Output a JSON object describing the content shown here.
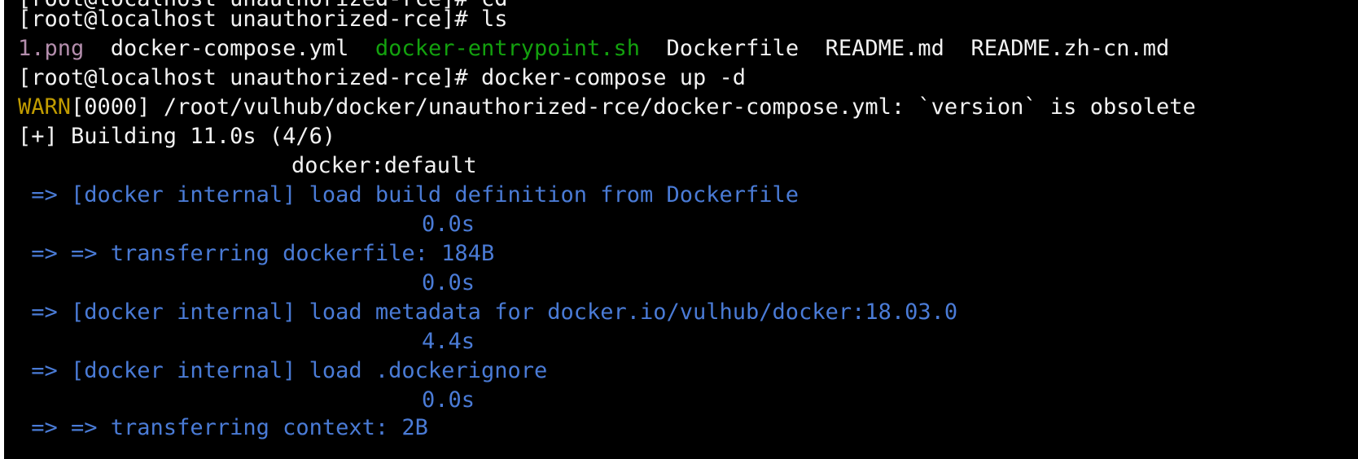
{
  "terminal": {
    "partial_top_line": "[root@localhost unauthorized-rce]# cd",
    "lines": [
      {
        "prompt": "[root@localhost unauthorized-rce]# ",
        "command": "ls"
      },
      {
        "files": [
          "1.png",
          "docker-compose.yml",
          "docker-entrypoint.sh",
          "Dockerfile",
          "README.md",
          "README.zh-cn.md"
        ]
      },
      {
        "prompt": "[root@localhost unauthorized-rce]# ",
        "command": "docker-compose up -d"
      },
      {
        "warn_tag": "WARN",
        "warn_rest": "[0000] /root/vulhub/docker/unauthorized-rce/docker-compose.yml: `version` is obsolete"
      },
      {
        "text": "[+] Building 11.0s (4/6)"
      },
      {
        "text": "docker:default"
      },
      {
        "text": " => [docker internal] load build definition from Dockerfile"
      },
      {
        "text": "0.0s"
      },
      {
        "text": " => => transferring dockerfile: 184B"
      },
      {
        "text": "0.0s"
      },
      {
        "text": " => [docker internal] load metadata for docker.io/vulhub/docker:18.03.0"
      },
      {
        "text": "4.4s"
      },
      {
        "text": " => [docker internal] load .dockerignore"
      },
      {
        "text": "0.0s"
      },
      {
        "text": " => => transferring context: 2B"
      }
    ]
  },
  "colors": {
    "background": "#000000",
    "text": "#f2f2f2",
    "image_file": "#b48ead",
    "executable_file": "#13a10e",
    "warn": "#c19c00",
    "build_step": "#4a7bd6"
  }
}
